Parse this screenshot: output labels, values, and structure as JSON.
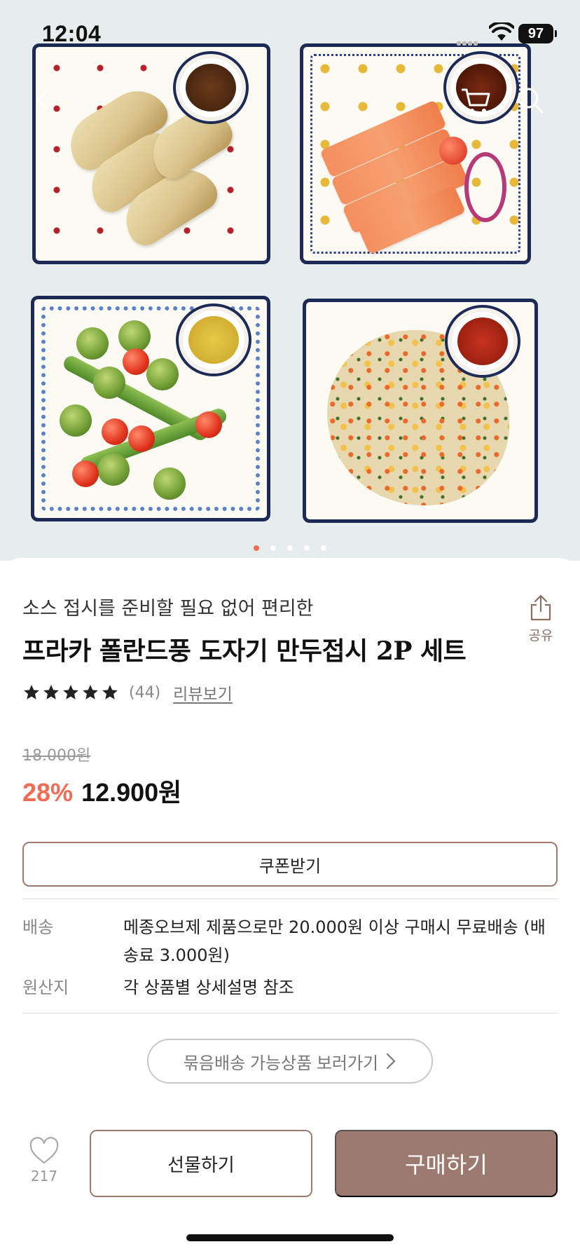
{
  "status_bar": {
    "time": "12:04",
    "battery": "97"
  },
  "hero": {
    "page_count": 5,
    "active_page": 1,
    "accent_color": "#f26c55"
  },
  "product": {
    "subtitle": "소스 접시를 준비할 필요 없어 편리한",
    "title": "프라카 폴란드풍 도자기 만두접시 2P 세트",
    "rating": 5,
    "review_count": "(44)",
    "review_link": "리뷰보기",
    "original_price": "18.000원",
    "discount": "28%",
    "price": "12.900원",
    "discount_color": "#f26c55"
  },
  "share": {
    "label": "공유"
  },
  "coupon": {
    "label": "쿠폰받기"
  },
  "info": {
    "shipping_label": "배송",
    "shipping_value": "메종오브제 제품으로만 20.000원 이상 구매시 무료배송 (배송료 3.000원)",
    "origin_label": "원산지",
    "origin_value": "각 상품별 상세설명 참조"
  },
  "bundle": {
    "label": "묶음배송 가능상품 보러가기"
  },
  "actions": {
    "like_count": "217",
    "gift_label": "선물하기",
    "buy_label": "구매하기",
    "brand_color": "#9d7a70"
  },
  "icons": [
    "back-icon",
    "cart-icon",
    "search-icon",
    "share-icon",
    "star-icon",
    "chevron-right-icon",
    "heart-icon",
    "wifi-icon"
  ]
}
